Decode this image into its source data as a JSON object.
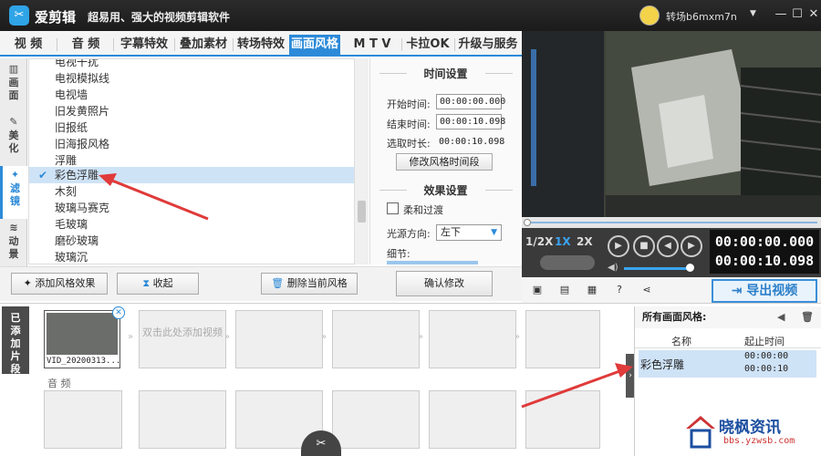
{
  "titlebar": {
    "app_name": "爱剪辑",
    "slogan": "超易用、强大的视频剪辑软件",
    "username": "转场b6mxm7n",
    "minimize": "—",
    "maximize": "☐",
    "close": "✕"
  },
  "tabs": [
    {
      "label": "视  频"
    },
    {
      "label": "音  频"
    },
    {
      "label": "字幕特效"
    },
    {
      "label": "叠加素材"
    },
    {
      "label": "转场特效"
    },
    {
      "label": "画面风格"
    },
    {
      "label": "M T V"
    },
    {
      "label": "卡拉OK"
    },
    {
      "label": "升级与服务"
    }
  ],
  "leftnav": [
    {
      "label": "画面"
    },
    {
      "label": "美化"
    },
    {
      "label": "滤镜"
    },
    {
      "label": "动景"
    }
  ],
  "filter_list": [
    {
      "label": "电视干扰"
    },
    {
      "label": "电视模拟线"
    },
    {
      "label": "电视墙"
    },
    {
      "label": "旧发黄照片"
    },
    {
      "label": "旧报纸"
    },
    {
      "label": "旧海报风格"
    },
    {
      "label": "浮雕"
    },
    {
      "label": "彩色浮雕"
    },
    {
      "label": "木刻"
    },
    {
      "label": "玻璃马赛克"
    },
    {
      "label": "毛玻璃"
    },
    {
      "label": "磨砂玻璃"
    },
    {
      "label": "玻璃沉"
    }
  ],
  "time_settings": {
    "heading": "时间设置",
    "start_label": "开始时间:",
    "start_value": "00:00:00.000",
    "end_label": "结束时间:",
    "end_value": "00:00:10.098",
    "duration_label": "选取时长:",
    "duration_value": "00:00:10.098",
    "modify_button": "修改风格时间段"
  },
  "effect_settings": {
    "heading": "效果设置",
    "soft_transition": "柔和过渡",
    "light_dir_label": "光源方向:",
    "light_dir_value": "左下",
    "detail_label": "细节:"
  },
  "actions": {
    "add_effect": "添加风格效果",
    "collapse": "收起",
    "delete_current": "删除当前风格",
    "confirm": "确认修改"
  },
  "player": {
    "speed_half": "1/2X",
    "speed_1": "1X",
    "speed_2": "2X",
    "current_time": "00:00:00.000",
    "total_time": "00:00:10.098",
    "export_button": "导出视频"
  },
  "timeline": {
    "added_clips_label": "已添加片段",
    "clip_name": "VID_20200313...",
    "add_clip_hint": "双击此处添加视频",
    "audio_label": "音  频"
  },
  "applied_styles": {
    "heading": "所有画面风格:",
    "col_name": "名称",
    "col_time": "起止时间",
    "row_name": "彩色浮雕",
    "row_start": "00:00:00",
    "row_end": "00:00:10"
  },
  "watermark": {
    "text": "晓枫资讯",
    "url": "bbs.yzwsb.com"
  },
  "colors": {
    "accent": "#2c8ad8",
    "selection": "#cfe3f7",
    "arrow_red": "#e03a3a"
  }
}
